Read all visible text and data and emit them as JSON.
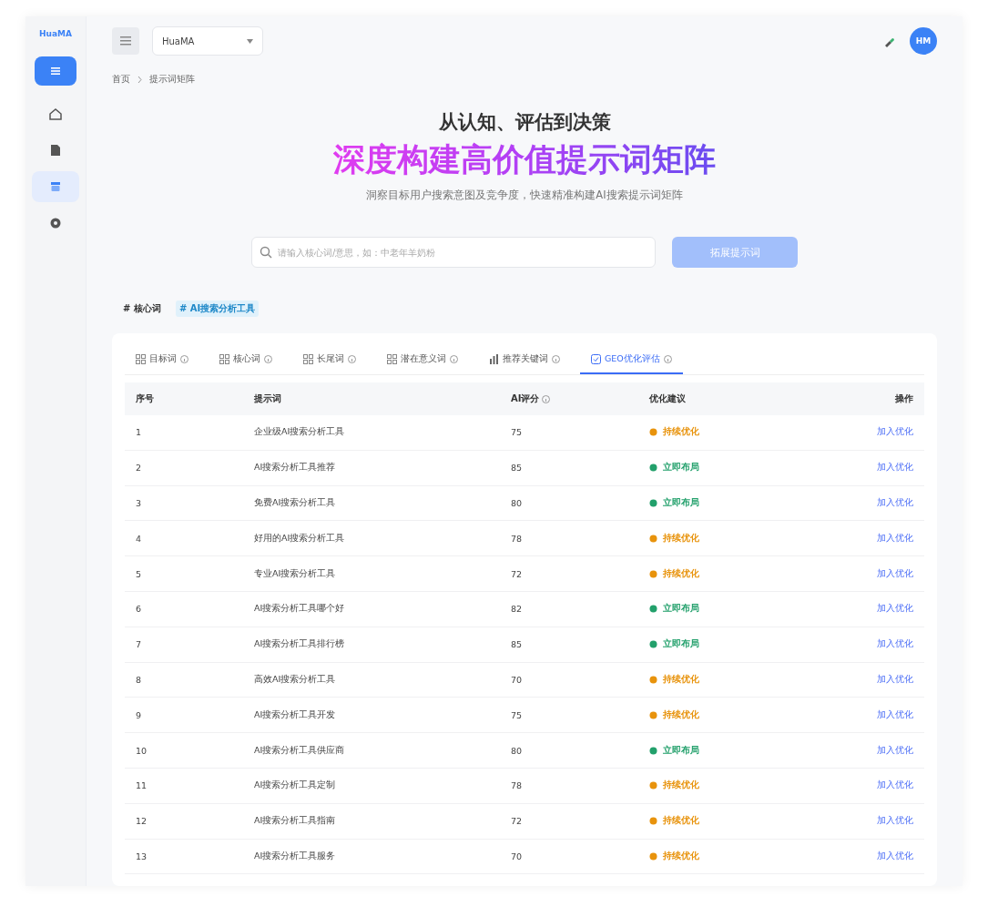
{
  "sidebar": {
    "logo": "HuaMA",
    "items": [
      {
        "kind": "home",
        "selected": false
      },
      {
        "kind": "document",
        "selected": false
      },
      {
        "kind": "box",
        "selected": true
      },
      {
        "kind": "settings",
        "selected": false
      }
    ]
  },
  "topbar": {
    "project_select": "HuaMA",
    "avatar": "HM"
  },
  "breadcrumb": [
    "首页",
    "提示词矩阵"
  ],
  "hero": {
    "eyebrow": "从认知、评估到决策",
    "title": "深度构建高价值提示词矩阵",
    "subtitle": "洞察目标用户搜索意图及竞争度，快速精准构建AI搜索提示词矩阵"
  },
  "search": {
    "placeholder": "请输入核心词/意思，如：中老年羊奶粉",
    "button": "拓展提示词"
  },
  "keyword_tags": [
    {
      "label": "# 核心词",
      "selected": false
    },
    {
      "label": "# AI搜索分析工具",
      "selected": true
    }
  ],
  "tabs": [
    {
      "label": "目标词",
      "kind": "grid",
      "selected": false
    },
    {
      "label": "核心词",
      "kind": "grid",
      "selected": false
    },
    {
      "label": "长尾词",
      "kind": "grid",
      "selected": false
    },
    {
      "label": "潜在意义词",
      "kind": "grid",
      "selected": false
    },
    {
      "label": "推荐关键词",
      "kind": "chart",
      "selected": false
    },
    {
      "label": "GEO优化评估",
      "kind": "check",
      "selected": true
    }
  ],
  "table": {
    "columns": [
      {
        "label": "序号",
        "info": false
      },
      {
        "label": "提示词",
        "info": false
      },
      {
        "label": "AI评分",
        "info": true
      },
      {
        "label": "优化建议",
        "info": false
      },
      {
        "label": "操作",
        "info": false
      }
    ],
    "rows": [
      {
        "index": "1",
        "prompt": "企业级AI搜索分析工具",
        "score": "75",
        "advice": {
          "kind": "warn",
          "text": "持续优化"
        },
        "action": "加入优化"
      },
      {
        "index": "2",
        "prompt": "AI搜索分析工具推荐",
        "score": "85",
        "advice": {
          "kind": "good",
          "text": "立即布局"
        },
        "action": "加入优化"
      },
      {
        "index": "3",
        "prompt": "免费AI搜索分析工具",
        "score": "80",
        "advice": {
          "kind": "good",
          "text": "立即布局"
        },
        "action": "加入优化"
      },
      {
        "index": "4",
        "prompt": "好用的AI搜索分析工具",
        "score": "78",
        "advice": {
          "kind": "warn",
          "text": "持续优化"
        },
        "action": "加入优化"
      },
      {
        "index": "5",
        "prompt": "专业AI搜索分析工具",
        "score": "72",
        "advice": {
          "kind": "warn",
          "text": "持续优化"
        },
        "action": "加入优化"
      },
      {
        "index": "6",
        "prompt": "AI搜索分析工具哪个好",
        "score": "82",
        "advice": {
          "kind": "good",
          "text": "立即布局"
        },
        "action": "加入优化"
      },
      {
        "index": "7",
        "prompt": "AI搜索分析工具排行榜",
        "score": "85",
        "advice": {
          "kind": "good",
          "text": "立即布局"
        },
        "action": "加入优化"
      },
      {
        "index": "8",
        "prompt": "高效AI搜索分析工具",
        "score": "70",
        "advice": {
          "kind": "warn",
          "text": "持续优化"
        },
        "action": "加入优化"
      },
      {
        "index": "9",
        "prompt": "AI搜索分析工具开发",
        "score": "75",
        "advice": {
          "kind": "warn",
          "text": "持续优化"
        },
        "action": "加入优化"
      },
      {
        "index": "10",
        "prompt": "AI搜索分析工具供应商",
        "score": "80",
        "advice": {
          "kind": "good",
          "text": "立即布局"
        },
        "action": "加入优化"
      },
      {
        "index": "11",
        "prompt": "AI搜索分析工具定制",
        "score": "78",
        "advice": {
          "kind": "warn",
          "text": "持续优化"
        },
        "action": "加入优化"
      },
      {
        "index": "12",
        "prompt": "AI搜索分析工具指南",
        "score": "72",
        "advice": {
          "kind": "warn",
          "text": "持续优化"
        },
        "action": "加入优化"
      },
      {
        "index": "13",
        "prompt": "AI搜索分析工具服务",
        "score": "70",
        "advice": {
          "kind": "warn",
          "text": "持续优化"
        },
        "action": "加入优化"
      }
    ]
  }
}
